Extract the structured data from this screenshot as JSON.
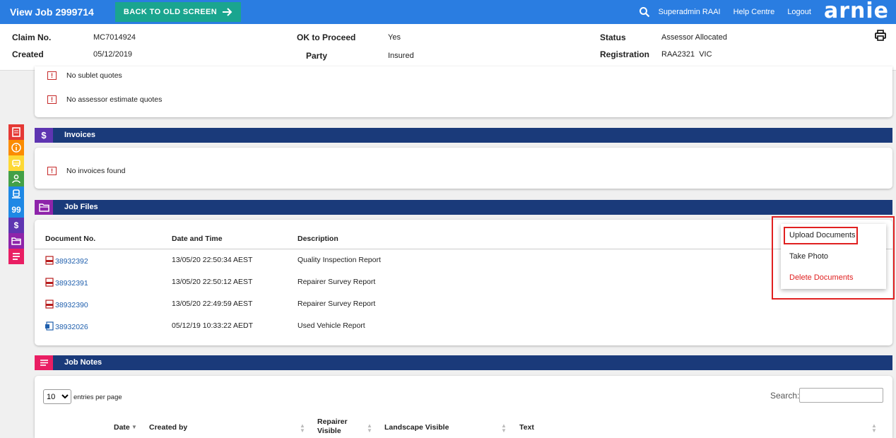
{
  "topbar": {
    "title": "View Job 2999714",
    "back_label": "BACK TO OLD SCREEN",
    "user": "Superadmin RAAI",
    "help": "Help Centre",
    "logout": "Logout",
    "logo": "arnie"
  },
  "info": {
    "claim_label": "Claim No.",
    "claim_value": "MC7014924",
    "created_label": "Created",
    "created_value": "05/12/2019",
    "ok_label": "OK to Proceed",
    "ok_value": "Yes",
    "party_label": "Party",
    "party_value": "Insured",
    "status_label": "Status",
    "status_value": "Assessor Allocated",
    "reg_label": "Registration",
    "reg_value": "RAA2321  VIC"
  },
  "side": {
    "colors": [
      "#e53935",
      "#fb8c00",
      "#fdd835",
      "#43a047",
      "#1e88e5",
      "#1e88e5",
      "#5e35b1",
      "#8e24aa",
      "#e91e63"
    ],
    "quote_glyph": "99",
    "dollar_glyph": "$"
  },
  "quotes": {
    "sublet": "No sublet quotes",
    "assessor": "No assessor estimate quotes"
  },
  "invoices": {
    "title": "Invoices",
    "icon": "$",
    "empty": "No invoices found"
  },
  "job_files": {
    "title": "Job Files",
    "headers": [
      "Document No.",
      "Date and Time",
      "Description"
    ],
    "rows": [
      {
        "doc": "38932392",
        "date": "13/05/20 22:50:34 AEST",
        "desc": "Quality Inspection Report"
      },
      {
        "doc": "38932391",
        "date": "13/05/20 22:50:12 AEST",
        "desc": "Repairer Survey Report"
      },
      {
        "doc": "38932390",
        "date": "13/05/20 22:49:59 AEST",
        "desc": "Repairer Survey Report"
      },
      {
        "doc": "38932026",
        "date": "05/12/19 10:33:22 AEDT",
        "desc": "Used Vehicle Report"
      }
    ],
    "menu": {
      "upload": "Upload Documents",
      "photo": "Take Photo",
      "delete": "Delete Documents"
    }
  },
  "job_notes": {
    "title": "Job Notes",
    "entries_value": "10",
    "entries_label": "entries per page",
    "search_label": "Search:",
    "headers": {
      "date": "Date",
      "created_by": "Created by",
      "repairer": "Repairer Visible",
      "landscape": "Landscape Visible",
      "text": "Text"
    }
  },
  "colors": {
    "topbar": "#2a7de1",
    "back_button": "#1aa58f",
    "section_bar": "#1a3a7a",
    "invoice_icon": "#5e35b1",
    "files_icon": "#8e24aa",
    "notes_icon": "#e91e63",
    "warning": "#c62828",
    "delete": "#e02020"
  }
}
